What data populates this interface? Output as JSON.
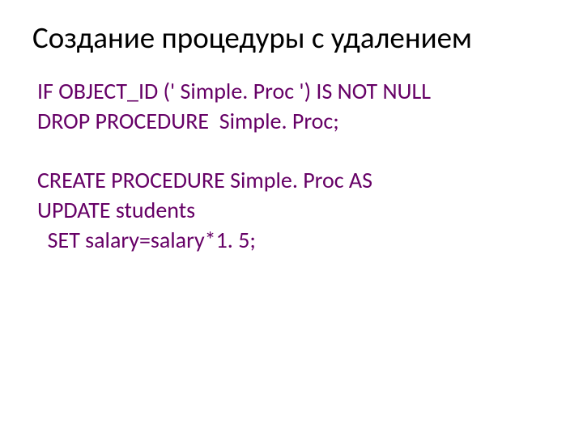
{
  "title": "Создание процедуры с удалением",
  "code": {
    "line1": "IF OBJECT_ID (' Simple. Proc ') IS NOT NULL",
    "line2": "DROP PROCEDURE  Simple. Proc;",
    "line3": "CREATE PROCEDURE Simple. Proc AS",
    "line4": "UPDATE students",
    "line5": "  SET salary=salary*1. 5;"
  }
}
